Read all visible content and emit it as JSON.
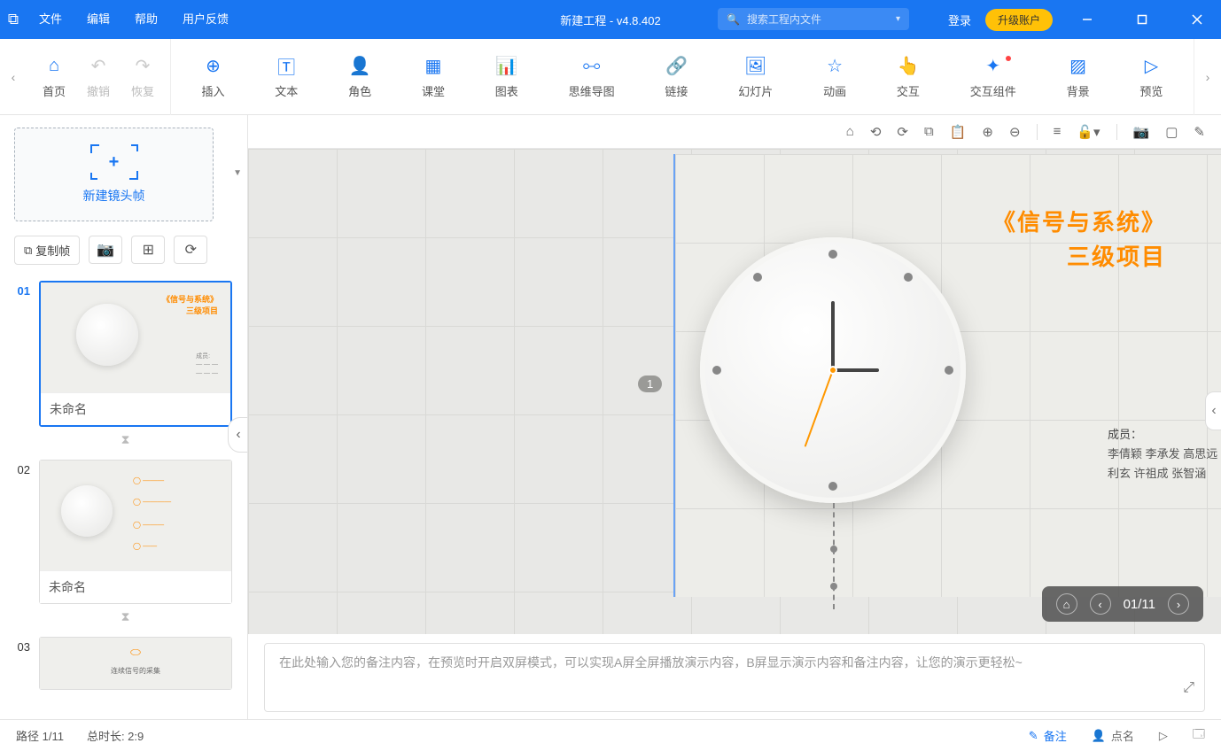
{
  "menu": {
    "file": "文件",
    "edit": "编辑",
    "help": "帮助",
    "feedback": "用户反馈"
  },
  "title": "新建工程 - v4.8.402",
  "search": {
    "placeholder": "搜索工程内文件"
  },
  "login": "登录",
  "upgrade": "升级账户",
  "toolbar": {
    "home": "首页",
    "undo": "撤销",
    "redo": "恢复",
    "insert": "插入",
    "text": "文本",
    "role": "角色",
    "class": "课堂",
    "chart": "图表",
    "mindmap": "思维导图",
    "link": "链接",
    "slideshow": "幻灯片",
    "anim": "动画",
    "interact": "交互",
    "components": "交互组件",
    "bg": "背景",
    "preview": "预览"
  },
  "sidebar": {
    "new_keyframe": "新建镜头帧",
    "copy_frame": "复制帧",
    "slides": [
      {
        "num": "01",
        "label": "未命名"
      },
      {
        "num": "02",
        "label": "未命名"
      },
      {
        "num": "03",
        "label": ""
      }
    ]
  },
  "slide": {
    "title_l1": "《信号与系统》",
    "title_l2": "三级项目",
    "members_h": "成员：",
    "members_l1": "李倩颖  李承发  高思远",
    "members_l2": "利玄    许祖成  张智涵",
    "path_idx": "1"
  },
  "canvas_nav": {
    "pages": "01/11"
  },
  "notes": {
    "placeholder": "在此处输入您的备注内容，在预览时开启双屏模式，可以实现A屏全屏播放演示内容，B屏显示演示内容和备注内容，让您的演示更轻松~"
  },
  "status": {
    "path": "路径 1/11",
    "duration": "总时长: 2:9",
    "notes": "备注",
    "roll": "点名"
  }
}
